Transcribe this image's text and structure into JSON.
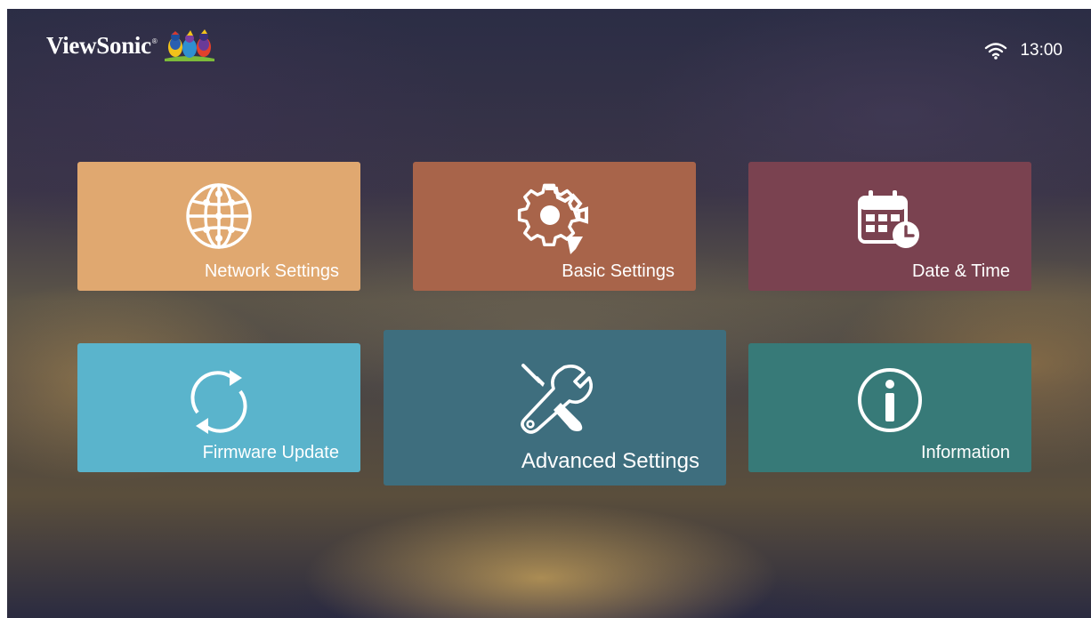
{
  "header": {
    "brand": "ViewSonic",
    "brand_mark": "®",
    "logo_icon": "viewsonic-birds-logo",
    "wifi_icon": "wifi-icon",
    "time": "13:00"
  },
  "tiles": [
    {
      "label": "Network Settings",
      "icon": "globe-network-icon",
      "color": "#e0a870"
    },
    {
      "label": "Basic Settings",
      "icon": "gear-settings-icon",
      "color": "#a8644a"
    },
    {
      "label": "Date & Time",
      "icon": "calendar-clock-icon",
      "color": "#7a4250"
    },
    {
      "label": "Firmware Update",
      "icon": "refresh-icon",
      "color": "#5ab4cc"
    },
    {
      "label": "Advanced Settings",
      "icon": "tools-icon",
      "color": "#3e6e7e",
      "selected": true
    },
    {
      "label": "Information",
      "icon": "info-icon",
      "color": "#377a78"
    }
  ]
}
